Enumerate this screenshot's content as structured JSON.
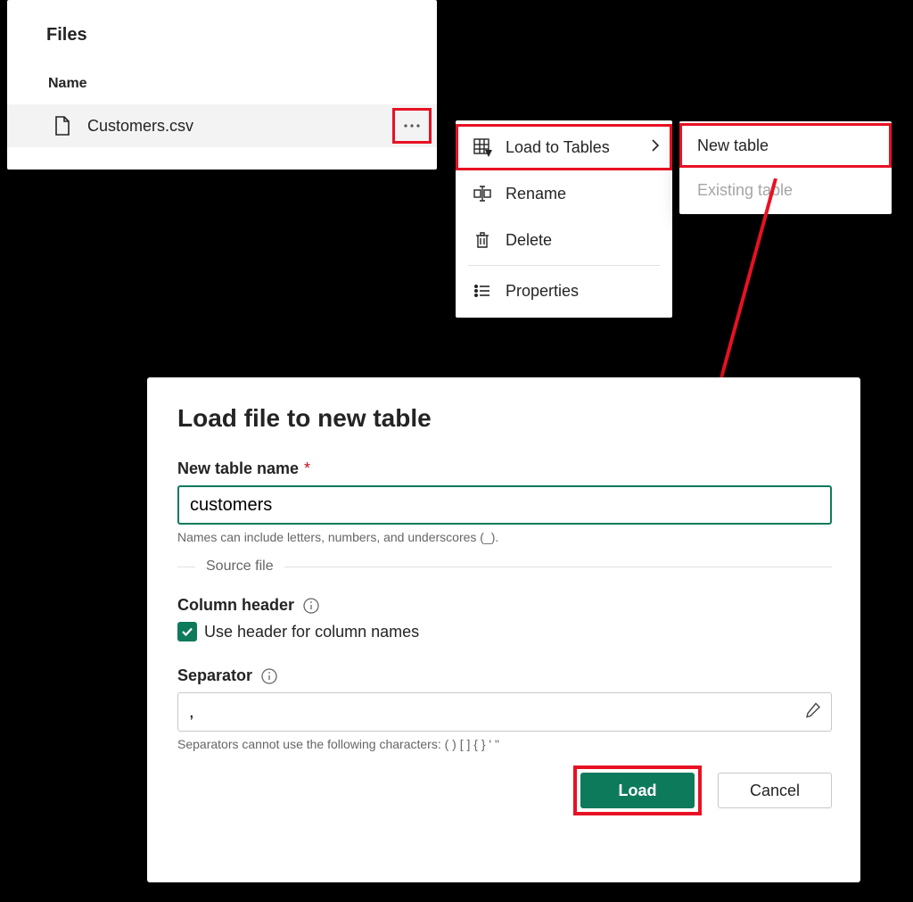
{
  "files_panel": {
    "title": "Files",
    "column_header": "Name",
    "file_name": "Customers.csv"
  },
  "context_menu": {
    "load_to_tables": "Load to Tables",
    "rename": "Rename",
    "delete": "Delete",
    "properties": "Properties"
  },
  "submenu": {
    "new_table": "New table",
    "existing_table": "Existing table"
  },
  "dialog": {
    "title": "Load file to new table",
    "name_label": "New table name",
    "name_value": "customers",
    "name_hint": "Names can include letters, numbers, and underscores (_).",
    "source_file": "Source file",
    "column_header_label": "Column header",
    "use_header_label": "Use header for column names",
    "separator_label": "Separator",
    "separator_value": ",",
    "separator_hint": "Separators cannot use the following characters: ( ) [ ] { } ' \"",
    "load_button": "Load",
    "cancel_button": "Cancel"
  },
  "annotations": {
    "highlight_color": "#e81123"
  }
}
